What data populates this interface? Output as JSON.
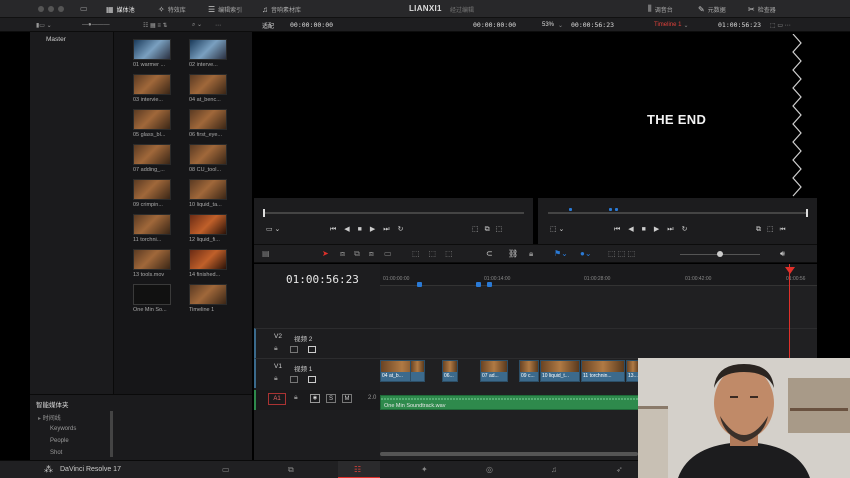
{
  "topbar": {
    "tabs": [
      {
        "label": "媒体池",
        "icon": "media-pool-icon"
      },
      {
        "label": "特效库",
        "icon": "effects-icon"
      },
      {
        "label": "编辑索引",
        "icon": "edit-index-icon"
      },
      {
        "label": "音响素材库",
        "icon": "sound-library-icon"
      }
    ],
    "project_title": "LIANXI1",
    "project_subtitle": "经过编辑",
    "right_tabs": [
      {
        "label": "调音台",
        "icon": "mixer-icon"
      },
      {
        "label": "元数据",
        "icon": "metadata-icon"
      },
      {
        "label": "检查器",
        "icon": "inspector-icon"
      }
    ]
  },
  "toolbar2": {
    "fit_label": "适配",
    "source_timecode": "00:00:00:00",
    "program_timecode_left": "00:00:00:00",
    "zoom": "53%",
    "duration": "00:00:56:23",
    "timeline_name": "Timeline 1",
    "program_timecode": "01:00:56:23"
  },
  "bins": {
    "master": "Master"
  },
  "media_pool": {
    "clips": [
      {
        "label": "01 warmer ...",
        "style": "blue"
      },
      {
        "label": "02 interve...",
        "style": "blue"
      },
      {
        "label": "03 intervie...",
        "style": "normal"
      },
      {
        "label": "04 at_benc...",
        "style": "normal"
      },
      {
        "label": "05 glass_bl...",
        "style": "normal"
      },
      {
        "label": "06 first_eye...",
        "style": "normal"
      },
      {
        "label": "07 adding_...",
        "style": "normal"
      },
      {
        "label": "08 CU_tool...",
        "style": "normal"
      },
      {
        "label": "09 crimpin...",
        "style": "normal"
      },
      {
        "label": "10 liquid_ta...",
        "style": "normal"
      },
      {
        "label": "11 torchni...",
        "style": "normal"
      },
      {
        "label": "12 liquid_fi...",
        "style": "red"
      },
      {
        "label": "13 tools.mov",
        "style": "normal"
      },
      {
        "label": "14 finished...",
        "style": "red"
      },
      {
        "label": "One Min So...",
        "style": "dark"
      },
      {
        "label": "Timeline 1",
        "style": "normal"
      }
    ]
  },
  "smart_bins": {
    "title": "智能媒体夹",
    "items": [
      "时间线",
      "Keywords",
      "People",
      "Shot"
    ]
  },
  "viewer": {
    "program_text": "THE END"
  },
  "timeline": {
    "timecode": "01:00:56:23",
    "ruler": [
      "01:00:00:00",
      "01:00:14:00",
      "01:00:28:00",
      "01:00:42:00",
      "01:00:56"
    ],
    "tracks": [
      {
        "id": "V2",
        "name": "视频 2"
      },
      {
        "id": "V1",
        "name": "视频 1"
      },
      {
        "id": "A1",
        "name": "",
        "level": "2.0"
      }
    ],
    "video_clips": [
      "04 at_b...",
      "",
      "06...",
      "07 ad...",
      "09 c...",
      "10 liquid_t...",
      "11 torchnin...",
      "13..."
    ],
    "audio_clip": "One Min Soundtrack.wav",
    "track_buttons": [
      "S",
      "M"
    ]
  },
  "bottombar": {
    "app_name": "DaVinci Resolve 17",
    "pages": [
      "media-page-icon",
      "cut-page-icon",
      "edit-page-icon",
      "fusion-page-icon",
      "color-page-icon",
      "fairlight-page-icon",
      "deliver-page-icon"
    ]
  },
  "colors": {
    "accent_red": "#e0302a",
    "audio_green": "#2e8a4c",
    "video_blue": "#3c6a8c",
    "marker_blue": "#2a7ad6"
  }
}
